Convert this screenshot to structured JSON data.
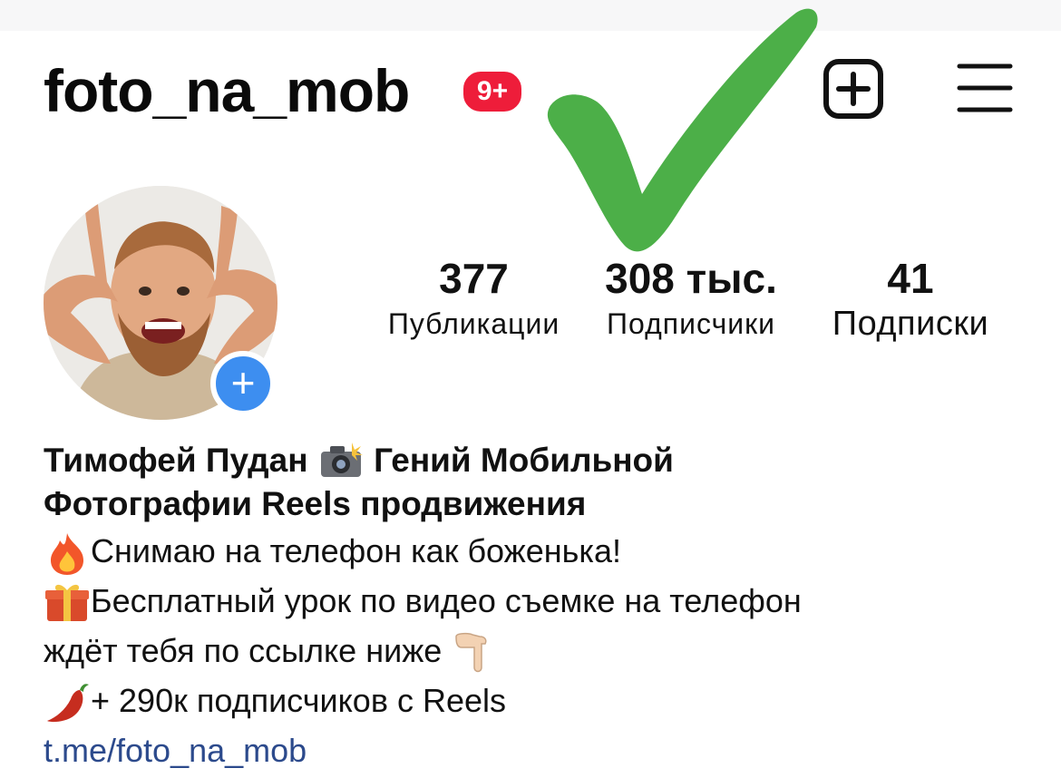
{
  "header": {
    "username": "foto_na_mob",
    "notification_badge": "9+",
    "new_post_icon": "plus-square-icon",
    "menu_icon": "hamburger-menu-icon"
  },
  "overlay": {
    "checkmark_color": "#4caf48"
  },
  "profile": {
    "add_story_icon": "plus-icon",
    "stats": {
      "posts": {
        "value": "377",
        "label": "Публикации"
      },
      "followers": {
        "value": "308 тыс.",
        "label": "Подписчики"
      },
      "following": {
        "value": "41",
        "label": "Подписки"
      }
    }
  },
  "bio": {
    "name_part1": "Тимофей Пудан",
    "name_part2": "Гений Мобильной",
    "name_line2": "Фотографии Reels продвижения",
    "line1": "Снимаю на телефон как боженька!",
    "line2": "Бесплатный урок по видео съемке на телефон",
    "line3": "ждёт тебя по ссылке ниже",
    "line4": "+ 290к подписчиков с Reels",
    "link": "t.me/foto_na_mob"
  },
  "colors": {
    "badge": "#ee1d3a",
    "add_story": "#3d8ef0",
    "link": "#2c4a8c",
    "top_strip": "#f7f7f8"
  }
}
